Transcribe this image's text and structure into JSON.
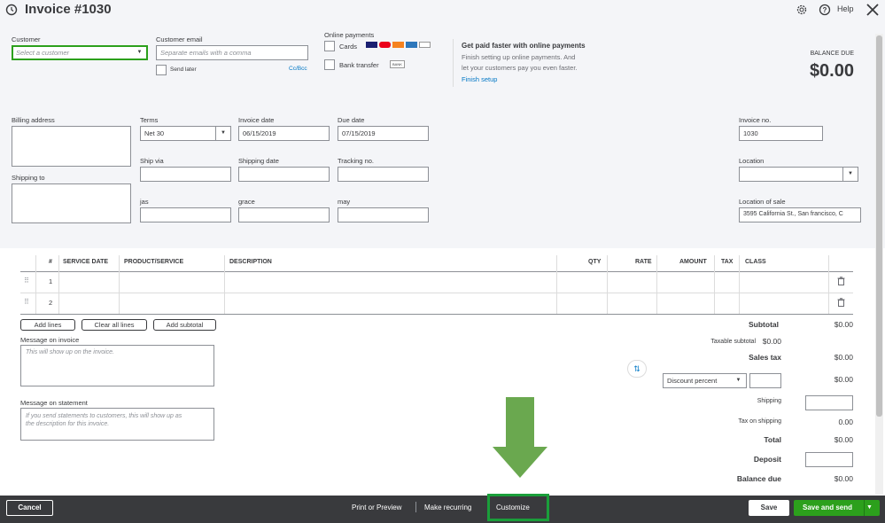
{
  "header": {
    "title": "Invoice #1030",
    "help": "Help"
  },
  "customer": {
    "label": "Customer",
    "placeholder": "Select a customer"
  },
  "email": {
    "label": "Customer email",
    "placeholder": "Separate emails with a comma",
    "send_later": "Send later",
    "ccbcc": "Cc/Bcc"
  },
  "online": {
    "label": "Online payments",
    "cards": "Cards",
    "bank": "Bank transfer",
    "bank_badge": "BANK"
  },
  "promo": {
    "title": "Get paid faster with online payments",
    "line1": "Finish setting up online payments. And",
    "line2": "let your customers pay you even faster.",
    "link": "Finish setup"
  },
  "balance": {
    "label": "BALANCE DUE",
    "value": "$0.00"
  },
  "billing": {
    "label": "Billing address"
  },
  "shipping_to": {
    "label": "Shipping to"
  },
  "terms": {
    "label": "Terms",
    "value": "Net 30"
  },
  "invoice_date": {
    "label": "Invoice date",
    "value": "06/15/2019"
  },
  "due_date": {
    "label": "Due date",
    "value": "07/15/2019"
  },
  "invoice_no": {
    "label": "Invoice no.",
    "value": "1030"
  },
  "ship_via": {
    "label": "Ship via"
  },
  "shipping_date": {
    "label": "Shipping date"
  },
  "tracking": {
    "label": "Tracking no."
  },
  "location": {
    "label": "Location"
  },
  "custom": {
    "f1": "jas",
    "f2": "grace",
    "f3": "may"
  },
  "location_of_sale": {
    "label": "Location of sale",
    "value": "3595 California St., San francisco, C"
  },
  "table": {
    "cols": {
      "num": "#",
      "service_date": "SERVICE DATE",
      "product": "PRODUCT/SERVICE",
      "desc": "DESCRIPTION",
      "qty": "QTY",
      "rate": "RATE",
      "amount": "AMOUNT",
      "tax": "TAX",
      "class": "CLASS"
    },
    "rows": [
      "1",
      "2"
    ]
  },
  "line_buttons": {
    "add": "Add lines",
    "clear": "Clear all lines",
    "subtotal": "Add subtotal"
  },
  "message_invoice": {
    "label": "Message on invoice",
    "placeholder": "This will show up on the invoice."
  },
  "message_statement": {
    "label": "Message on statement",
    "placeholder1": "If you send statements to customers, this will show up as",
    "placeholder2": "the description for this invoice."
  },
  "totals": {
    "subtotal_label": "Subtotal",
    "subtotal": "$0.00",
    "taxable_label": "Taxable subtotal",
    "taxable": "$0.00",
    "sales_tax_label": "Sales tax",
    "sales_tax": "$0.00",
    "discount_select": "Discount percent",
    "discount": "$0.00",
    "shipping_label": "Shipping",
    "tax_ship_label": "Tax on shipping",
    "tax_ship": "0.00",
    "total_label": "Total",
    "total": "$0.00",
    "deposit_label": "Deposit",
    "balance_label": "Balance due",
    "balance": "$0.00"
  },
  "footer": {
    "cancel": "Cancel",
    "print": "Print or Preview",
    "recurring": "Make recurring",
    "customize": "Customize",
    "save": "Save",
    "save_send": "Save and send"
  },
  "colors": {
    "accent": "#2ca01c",
    "arrow": "#6aa84f",
    "highlight": "#1a9e3a",
    "link": "#0077c5"
  }
}
